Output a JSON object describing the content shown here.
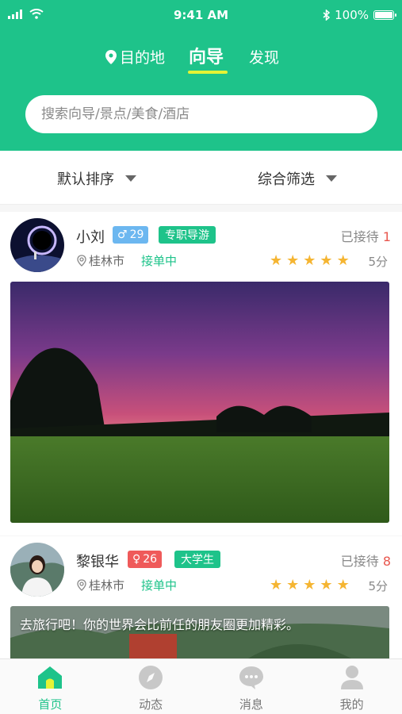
{
  "status_bar": {
    "time": "9:41 AM",
    "battery": "100%"
  },
  "top_nav": {
    "destination": "目的地",
    "guide": "向导",
    "discover": "发现"
  },
  "search": {
    "placeholder": "搜索向导/景点/美食/酒店"
  },
  "filters": {
    "sort": "默认排序",
    "filter": "综合筛选"
  },
  "guides": [
    {
      "name": "小刘",
      "gender_symbol": "♂",
      "age": "29",
      "tag": "专职导游",
      "location": "桂林市",
      "status": "接单中",
      "served_label": "已接待",
      "served_count": "1",
      "rating": 5,
      "score": "5分",
      "caption": ""
    },
    {
      "name": "黎银华",
      "gender_symbol": "♀",
      "age": "26",
      "tag": "大学生",
      "location": "桂林市",
      "status": "接单中",
      "served_label": "已接待",
      "served_count": "8",
      "rating": 5,
      "score": "5分",
      "caption": "去旅行吧！你的世界会比前任的朋友圈更加精彩。"
    }
  ],
  "tabbar": {
    "home": "首页",
    "feed": "动态",
    "messages": "消息",
    "mine": "我的"
  },
  "colors": {
    "brand": "#1ec38a",
    "male_badge": "#6cb7f0",
    "female_badge": "#ef5a5a",
    "tag_badge": "#1ec38a",
    "star": "#f5b532",
    "count": "#e8574e",
    "underline": "#e4f335"
  }
}
